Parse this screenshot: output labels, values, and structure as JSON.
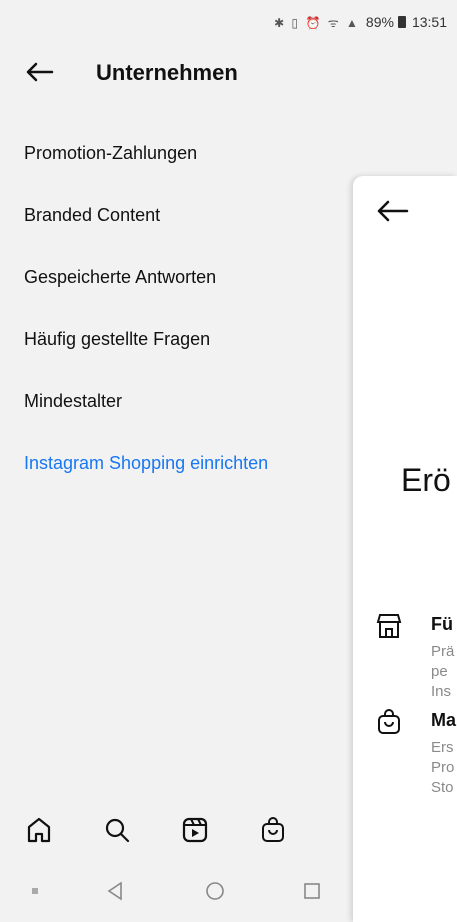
{
  "status_bar": {
    "battery": "89%",
    "time": "13:51"
  },
  "header": {
    "title": "Unternehmen"
  },
  "menu": [
    {
      "label": "Promotion-Zahlungen"
    },
    {
      "label": "Branded Content"
    },
    {
      "label": "Gespeicherte Antworten"
    },
    {
      "label": "Häufig gestellte Fragen"
    },
    {
      "label": "Mindestalter"
    },
    {
      "label": "Instagram Shopping einrichten",
      "accent": "#1877f2"
    }
  ],
  "overlay": {
    "title": "Erö",
    "features": [
      {
        "title": "Fü",
        "lines": [
          "Prä",
          "pe",
          "Ins"
        ],
        "icon": "storefront-icon"
      },
      {
        "title": "Ma",
        "lines": [
          "Ers",
          "Pro",
          "Sto"
        ],
        "icon": "shopping-bag-icon"
      }
    ]
  },
  "nav": {
    "icons": [
      "home-icon",
      "search-icon",
      "reels-icon",
      "shop-icon"
    ]
  },
  "system_nav": {
    "icons": [
      "square-small-icon",
      "back-triangle-icon",
      "home-circle-icon",
      "recent-square-icon"
    ]
  }
}
